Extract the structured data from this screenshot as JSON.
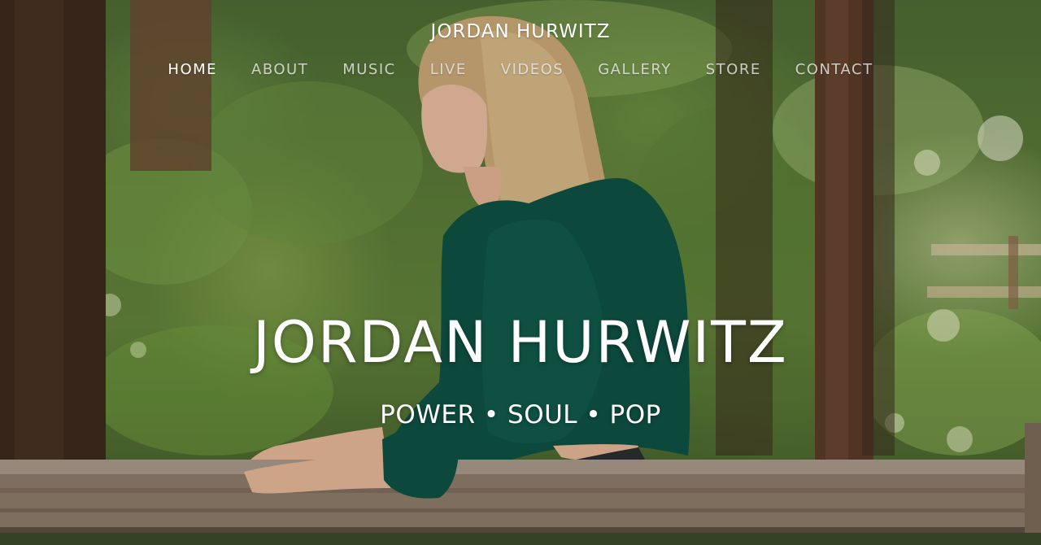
{
  "header": {
    "site_title": "JORDAN HURWITZ"
  },
  "nav": {
    "items": [
      {
        "label": "HOME",
        "active": true
      },
      {
        "label": "ABOUT",
        "active": false
      },
      {
        "label": "MUSIC",
        "active": false
      },
      {
        "label": "LIVE",
        "active": false
      },
      {
        "label": "VIDEOS",
        "active": false
      },
      {
        "label": "GALLERY",
        "active": false
      },
      {
        "label": "STORE",
        "active": false
      },
      {
        "label": "CONTACT",
        "active": false
      }
    ]
  },
  "hero": {
    "title": "JORDAN HURWITZ",
    "tagline": "POWER • SOUL • POP"
  },
  "colors": {
    "text": "#ffffff",
    "nav_inactive": "#ebebe6"
  }
}
